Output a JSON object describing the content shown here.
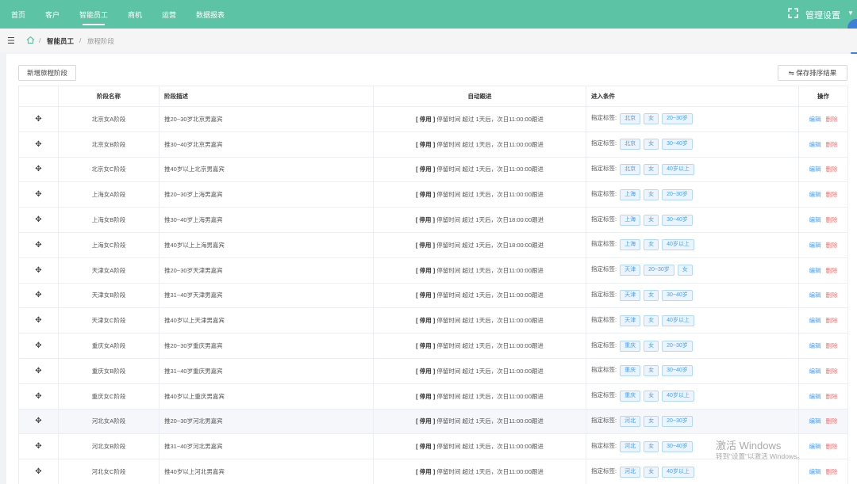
{
  "nav": {
    "items": [
      "首页",
      "客户",
      "智能员工",
      "商机",
      "运营",
      "数据报表"
    ],
    "active_index": 2,
    "admin_label": "管理设置",
    "caret": "▼"
  },
  "breadcrumb": [
    "智能员工",
    "旅程阶段"
  ],
  "breadcrumb_sep": "/",
  "toolbar": {
    "add_label": "新增旅程阶段",
    "save_sort_label": "保存排序结果",
    "save_sort_icon": "⇋"
  },
  "table": {
    "headers": [
      "",
      "阶段名称",
      "阶段描述",
      "自动跟进",
      "进入条件",
      "操作"
    ],
    "drag_icon": "✥",
    "cond_prefix": "指定标签:",
    "follow_status": "[ 停用 ]",
    "edit_label": "编辑",
    "delete_label": "删除",
    "rows": [
      {
        "name": "北京女A阶段",
        "desc": "推20~30岁北京男嘉宾",
        "follow": "停留时间 超过 1天后，次日11:00:00跟进",
        "tags": [
          "北京",
          "女",
          "20~30岁"
        ]
      },
      {
        "name": "北京女B阶段",
        "desc": "推30~40岁北京男嘉宾",
        "follow": "停留时间 超过 1天后，次日11:00:00跟进",
        "tags": [
          "北京",
          "女",
          "30~40岁"
        ]
      },
      {
        "name": "北京女C阶段",
        "desc": "推40岁以上北京男嘉宾",
        "follow": "停留时间 超过 1天后，次日11:00:00跟进",
        "tags": [
          "北京",
          "女",
          "40岁以上"
        ]
      },
      {
        "name": "上海女A阶段",
        "desc": "推20~30岁上海男嘉宾",
        "follow": "停留时间 超过 1天后，次日11:00:00跟进",
        "tags": [
          "上海",
          "女",
          "20~30岁"
        ]
      },
      {
        "name": "上海女B阶段",
        "desc": "推30~40岁上海男嘉宾",
        "follow": "停留时间 超过 1天后，次日18:00:00跟进",
        "tags": [
          "上海",
          "女",
          "30~40岁"
        ]
      },
      {
        "name": "上海女C阶段",
        "desc": "推40岁以上上海男嘉宾",
        "follow": "停留时间 超过 1天后，次日18:00:00跟进",
        "tags": [
          "上海",
          "女",
          "40岁以上"
        ]
      },
      {
        "name": "天津女A阶段",
        "desc": "推20~30岁天津男嘉宾",
        "follow": "停留时间 超过 1天后，次日11:00:00跟进",
        "tags": [
          "天津",
          "20~30岁",
          "女"
        ]
      },
      {
        "name": "天津女B阶段",
        "desc": "推31~40岁天津男嘉宾",
        "follow": "停留时间 超过 1天后，次日11:00:00跟进",
        "tags": [
          "天津",
          "女",
          "30~40岁"
        ]
      },
      {
        "name": "天津女C阶段",
        "desc": "推40岁以上天津男嘉宾",
        "follow": "停留时间 超过 1天后，次日11:00:00跟进",
        "tags": [
          "天津",
          "女",
          "40岁以上"
        ]
      },
      {
        "name": "重庆女A阶段",
        "desc": "推20~30岁重庆男嘉宾",
        "follow": "停留时间 超过 1天后，次日11:00:00跟进",
        "tags": [
          "重庆",
          "女",
          "20~30岁"
        ]
      },
      {
        "name": "重庆女B阶段",
        "desc": "推31~40岁重庆男嘉宾",
        "follow": "停留时间 超过 1天后，次日11:00:00跟进",
        "tags": [
          "重庆",
          "女",
          "30~40岁"
        ]
      },
      {
        "name": "重庆女C阶段",
        "desc": "推40岁以上重庆男嘉宾",
        "follow": "停留时间 超过 1天后，次日11:00:00跟进",
        "tags": [
          "重庆",
          "女",
          "40岁以上"
        ]
      },
      {
        "name": "河北女A阶段",
        "desc": "推20~30岁河北男嘉宾",
        "follow": "停留时间 超过 1天后，次日11:00:00跟进",
        "tags": [
          "河北",
          "女",
          "20~30岁"
        ]
      },
      {
        "name": "河北女B阶段",
        "desc": "推31~40岁河北男嘉宾",
        "follow": "停留时间 超过 1天后，次日11:00:00跟进",
        "tags": [
          "河北",
          "女",
          "30~40岁"
        ]
      },
      {
        "name": "河北女C阶段",
        "desc": "推40岁以上河北男嘉宾",
        "follow": "停留时间 超过 1天后，次日11:00:00跟进",
        "tags": [
          "河北",
          "女",
          "40岁以上"
        ]
      }
    ]
  },
  "watermark": {
    "line1": "激活 Windows",
    "line2": "转到\"设置\"以激活 Windows。"
  },
  "colors": {
    "nav_bg": "#5cc4a4",
    "tag_blue": "#409eff",
    "delete_red": "#f56c6c"
  },
  "icons": [
    "expand-icon",
    "menu-fold-icon",
    "home-icon",
    "drag-handle-icon",
    "swap-icon"
  ]
}
